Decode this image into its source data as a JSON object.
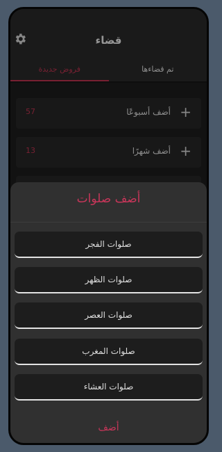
{
  "header": {
    "title": "قضاء"
  },
  "tabs": {
    "active": "فروض جديدة",
    "inactive": "تم قضاءها"
  },
  "rows": [
    {
      "label": "أضف أسبوعًا",
      "count": "57"
    },
    {
      "label": "أضف شهرًا",
      "count": "13"
    }
  ],
  "sheet": {
    "title": "أضف صلوات",
    "options": [
      "صلوات الفجر",
      "صلوات الظهر",
      "صلوات العصر",
      "صلوات المغرب",
      "صلوات العشاء"
    ],
    "add_label": "أضف"
  },
  "colors": {
    "accent": "#c9365a",
    "background": "#161616"
  }
}
